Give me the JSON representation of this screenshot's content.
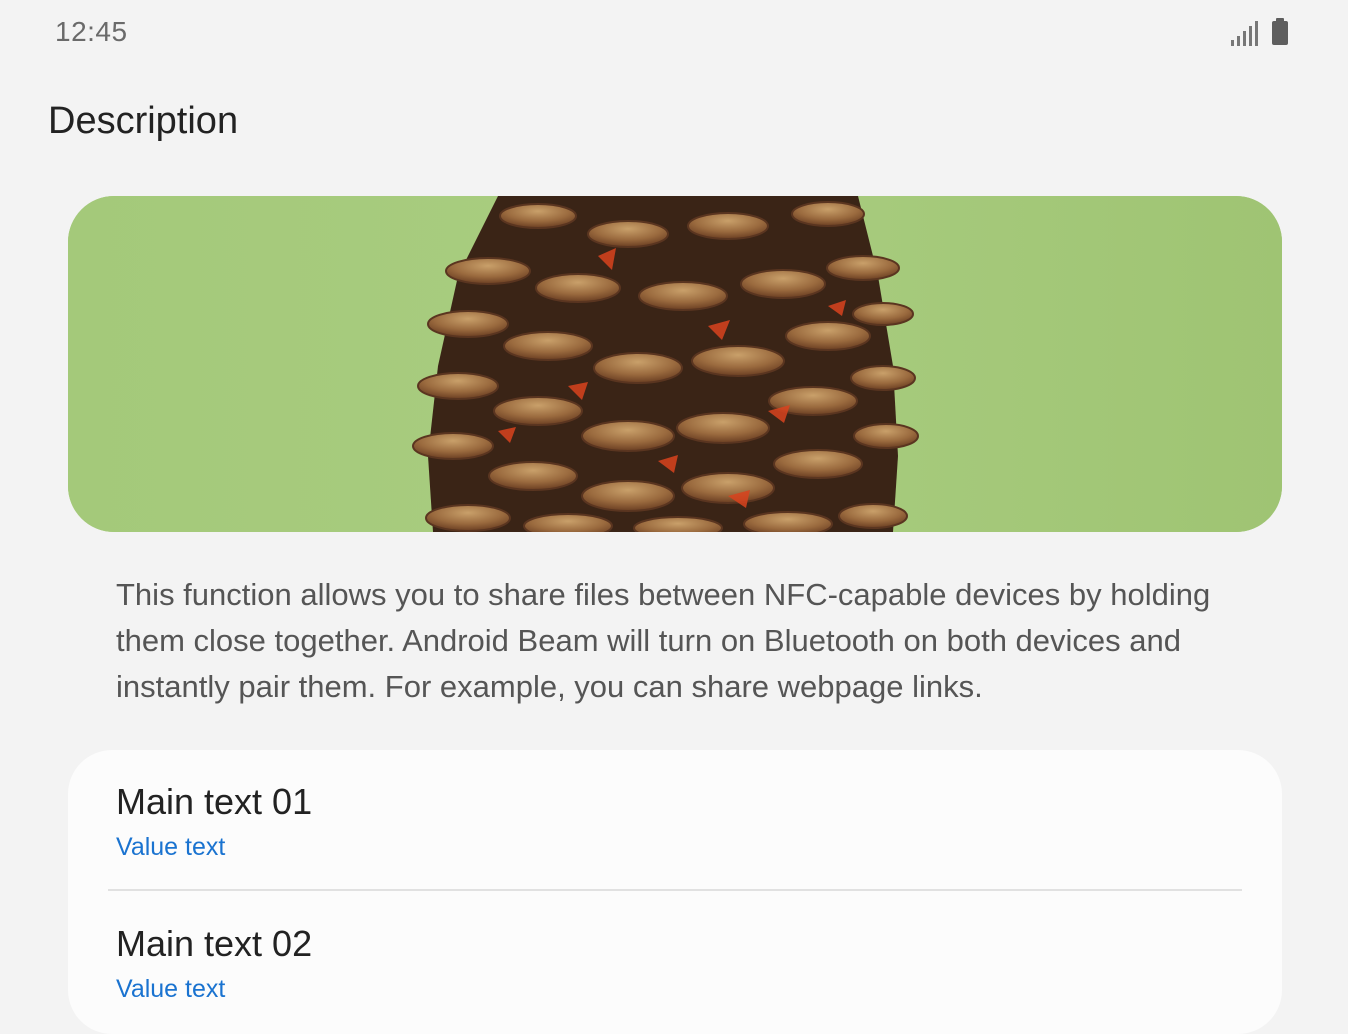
{
  "status_bar": {
    "time": "12:45",
    "icons": [
      "signal-icon",
      "battery-icon"
    ]
  },
  "page": {
    "title": "Description"
  },
  "hero": {
    "image": "pine-cone-on-green-background",
    "background_color": "#a2c878"
  },
  "description": {
    "text": "This function allows you to share files between NFC-capable devices by holding them close together. Android Beam will  turn on Bluetooth on both devices and instantly pair them. For example, you can share webpage links."
  },
  "list": {
    "items": [
      {
        "main": "Main text 01",
        "value": "Value text"
      },
      {
        "main": "Main text 02",
        "value": "Value text"
      }
    ]
  },
  "colors": {
    "background": "#f3f3f3",
    "card": "#fcfcfc",
    "accent": "#1a73d0",
    "primary_text": "#222222",
    "secondary_text": "#555555"
  }
}
